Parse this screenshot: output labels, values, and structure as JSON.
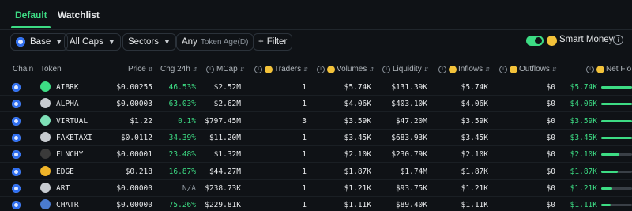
{
  "tabs": [
    {
      "label": "Default",
      "active": true
    },
    {
      "label": "Watchlist",
      "active": false
    }
  ],
  "filters": {
    "chain": "Base",
    "caps": "All Caps",
    "sectors": "Sectors",
    "age_value": "Any",
    "age_label": "Token Age(D)",
    "filter": "Filter",
    "smart_money": "Smart Money",
    "smart_money_on": true
  },
  "columns": {
    "chain": "Chain",
    "token": "Token",
    "price": "Price",
    "chg": "Chg 24h",
    "mcap": "MCap",
    "traders": "Traders",
    "volumes": "Volumes",
    "liquidity": "Liquidity",
    "inflows": "Inflows",
    "outflows": "Outflows",
    "netflow": "Net Flo"
  },
  "colors": {
    "accent": "#3ddc84",
    "background": "#0f1216",
    "chain": "#2f6ff0"
  },
  "rows": [
    {
      "token": "AIBRK",
      "icon": "robot-icon",
      "price": "$0.00255",
      "chg": "46.53%",
      "mcap": "$2.52M",
      "traders": "1",
      "volumes": "$5.74K",
      "liquidity": "$131.39K",
      "inflows": "$5.74K",
      "outflows": "$0",
      "netflow": "$5.74K",
      "flow_level": 1.0
    },
    {
      "token": "ALPHA",
      "icon": "diamond-icon",
      "price": "$0.00003",
      "chg": "63.03%",
      "mcap": "$2.62M",
      "traders": "1",
      "volumes": "$4.06K",
      "liquidity": "$403.10K",
      "inflows": "$4.06K",
      "outflows": "$0",
      "netflow": "$4.06K",
      "flow_level": 1.0
    },
    {
      "token": "VIRTUAL",
      "icon": "heart-icon",
      "price": "$1.22",
      "chg": "0.1%",
      "mcap": "$797.45M",
      "traders": "3",
      "volumes": "$3.59K",
      "liquidity": "$47.20M",
      "inflows": "$3.59K",
      "outflows": "$0",
      "netflow": "$3.59K",
      "flow_level": 1.0
    },
    {
      "token": "FAKETAXI",
      "icon": "diamond-icon",
      "price": "$0.0112",
      "chg": "34.39%",
      "mcap": "$11.20M",
      "traders": "1",
      "volumes": "$3.45K",
      "liquidity": "$683.93K",
      "inflows": "$3.45K",
      "outflows": "$0",
      "netflow": "$3.45K",
      "flow_level": 1.0
    },
    {
      "token": "FLNCHY",
      "icon": "shoe-icon",
      "price": "$0.00001",
      "chg": "23.48%",
      "mcap": "$1.32M",
      "traders": "1",
      "volumes": "$2.10K",
      "liquidity": "$230.79K",
      "inflows": "$2.10K",
      "outflows": "$0",
      "netflow": "$2.10K",
      "flow_level": 0.6
    },
    {
      "token": "EDGE",
      "icon": "triangle-icon",
      "price": "$0.218",
      "chg": "16.87%",
      "mcap": "$44.27M",
      "traders": "1",
      "volumes": "$1.87K",
      "liquidity": "$1.74M",
      "inflows": "$1.87K",
      "outflows": "$0",
      "netflow": "$1.87K",
      "flow_level": 0.55
    },
    {
      "token": "ART",
      "icon": "diamond-icon",
      "price": "$0.00000",
      "chg": "N/A",
      "mcap": "$238.73K",
      "traders": "1",
      "volumes": "$1.21K",
      "liquidity": "$93.75K",
      "inflows": "$1.21K",
      "outflows": "$0",
      "netflow": "$1.21K",
      "flow_level": 0.35
    },
    {
      "token": "CHATR",
      "icon": "chat-icon",
      "price": "$0.00000",
      "chg": "75.26%",
      "mcap": "$229.81K",
      "traders": "1",
      "volumes": "$1.11K",
      "liquidity": "$89.40K",
      "inflows": "$1.11K",
      "outflows": "$0",
      "netflow": "$1.11K",
      "flow_level": 0.3
    }
  ]
}
